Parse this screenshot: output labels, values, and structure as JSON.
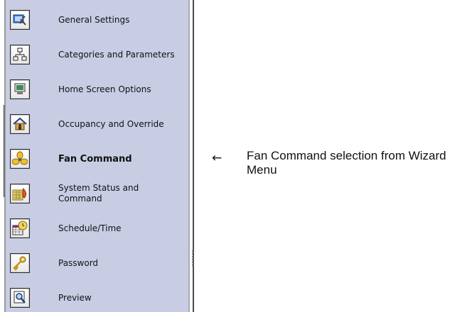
{
  "wizard_menu": {
    "items": [
      {
        "label": "General Settings",
        "icon": "tools-icon"
      },
      {
        "label": "Categories and Parameters",
        "icon": "hierarchy-icon"
      },
      {
        "label": "Home Screen Options",
        "icon": "monitor-icon"
      },
      {
        "label": "Occupancy and Override",
        "icon": "house-icon"
      },
      {
        "label": "Fan Command",
        "icon": "fan-icon",
        "selected": true
      },
      {
        "label": "System Status and Command",
        "icon": "flame-icon"
      },
      {
        "label": "Schedule/Time",
        "icon": "calendar-clock-icon"
      },
      {
        "label": "Password",
        "icon": "key-icon"
      },
      {
        "label": "Preview",
        "icon": "magnifier-icon"
      }
    ]
  },
  "annotation": {
    "arrow": "←",
    "caption": "Fan Command selection from Wizard Menu"
  }
}
